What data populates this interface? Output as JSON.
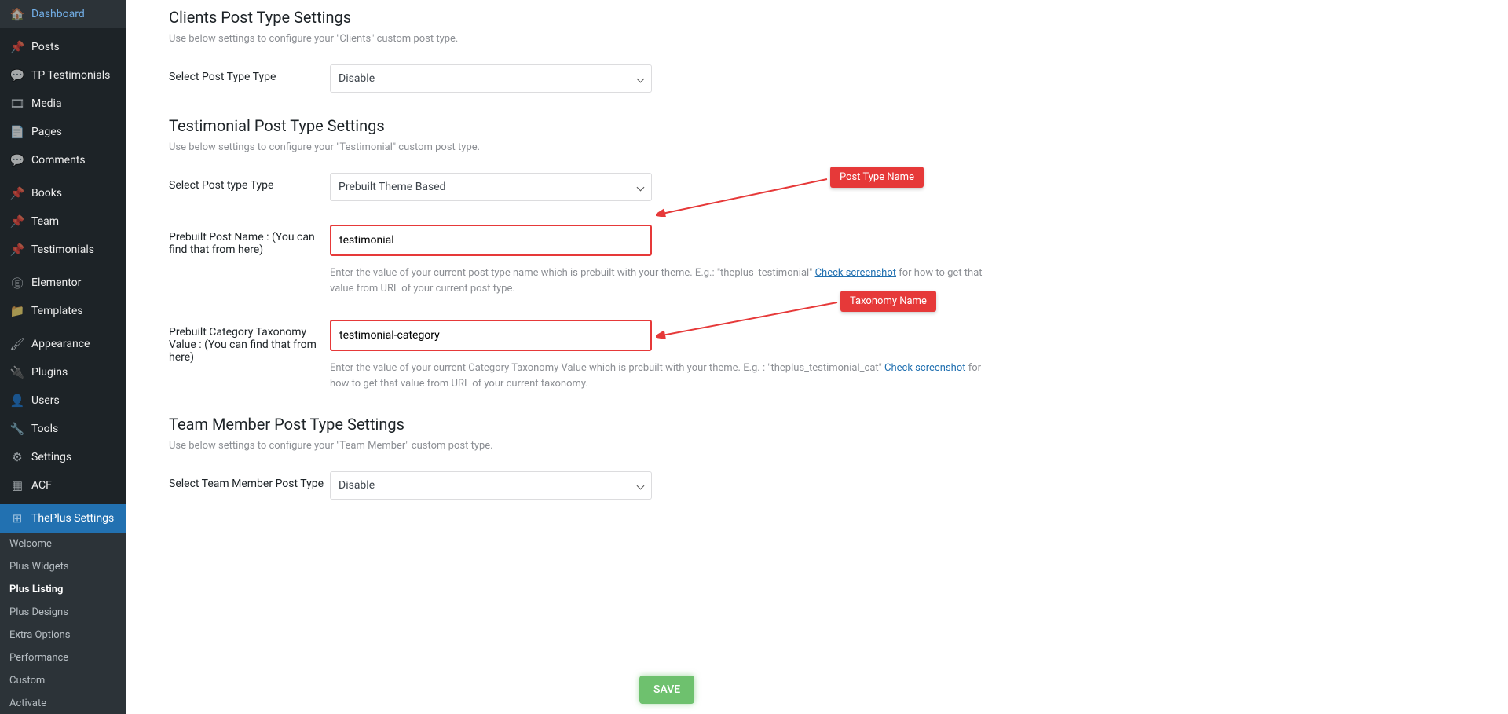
{
  "sidebar": {
    "items": [
      {
        "icon": "🏠",
        "label": "Dashboard"
      },
      {
        "icon": "📌",
        "label": "Posts"
      },
      {
        "icon": "💬",
        "label": "TP Testimonials"
      },
      {
        "icon": "🎞",
        "label": "Media"
      },
      {
        "icon": "📄",
        "label": "Pages"
      },
      {
        "icon": "💬",
        "label": "Comments"
      },
      {
        "icon": "📌",
        "label": "Books"
      },
      {
        "icon": "📌",
        "label": "Team"
      },
      {
        "icon": "📌",
        "label": "Testimonials"
      },
      {
        "icon": "Ⓔ",
        "label": "Elementor"
      },
      {
        "icon": "📁",
        "label": "Templates"
      },
      {
        "icon": "🖌",
        "label": "Appearance"
      },
      {
        "icon": "🔌",
        "label": "Plugins"
      },
      {
        "icon": "👤",
        "label": "Users"
      },
      {
        "icon": "🔧",
        "label": "Tools"
      },
      {
        "icon": "⚙",
        "label": "Settings"
      },
      {
        "icon": "▦",
        "label": "ACF"
      },
      {
        "icon": "⊞",
        "label": "ThePlus Settings",
        "active": true
      }
    ],
    "submenu": [
      {
        "label": "Welcome"
      },
      {
        "label": "Plus Widgets"
      },
      {
        "label": "Plus Listing",
        "active": true
      },
      {
        "label": "Plus Designs"
      },
      {
        "label": "Extra Options"
      },
      {
        "label": "Performance"
      },
      {
        "label": "Custom"
      },
      {
        "label": "Activate"
      }
    ]
  },
  "sections": {
    "clients": {
      "title": "Clients Post Type Settings",
      "desc": "Use below settings to configure your \"Clients\" custom post type.",
      "select_label": "Select Post Type Type",
      "select_value": "Disable"
    },
    "testimonial": {
      "title": "Testimonial Post Type Settings",
      "desc": "Use below settings to configure your \"Testimonial\" custom post type.",
      "select_label": "Select Post type Type",
      "select_value": "Prebuilt Theme Based",
      "post_name_label": "Prebuilt Post Name : (You can find that from here)",
      "post_name_value": "testimonial",
      "post_name_help_pre": "Enter the value of your current post type name which is prebuilt with your theme. E.g.: \"theplus_testimonial\" ",
      "post_name_help_link": "Check screenshot",
      "post_name_help_post": " for how to get that value from URL of your current post type.",
      "category_label": "Prebuilt Category Taxonomy Value : (You can find that from here)",
      "category_value": "testimonial-category",
      "category_help_pre": "Enter the value of your current Category Taxonomy Value which is prebuilt with your theme. E.g. : \"theplus_testimonial_cat\" ",
      "category_help_link": "Check screenshot",
      "category_help_post": " for how to get that value from URL of your current taxonomy."
    },
    "team": {
      "title": "Team Member Post Type Settings",
      "desc": "Use below settings to configure your \"Team Member\" custom post type.",
      "select_label": "Select Team Member Post Type",
      "select_value": "Disable"
    }
  },
  "badges": {
    "post_type_name": "Post Type Name",
    "taxonomy_name": "Taxonomy Name"
  },
  "save": "SAVE"
}
